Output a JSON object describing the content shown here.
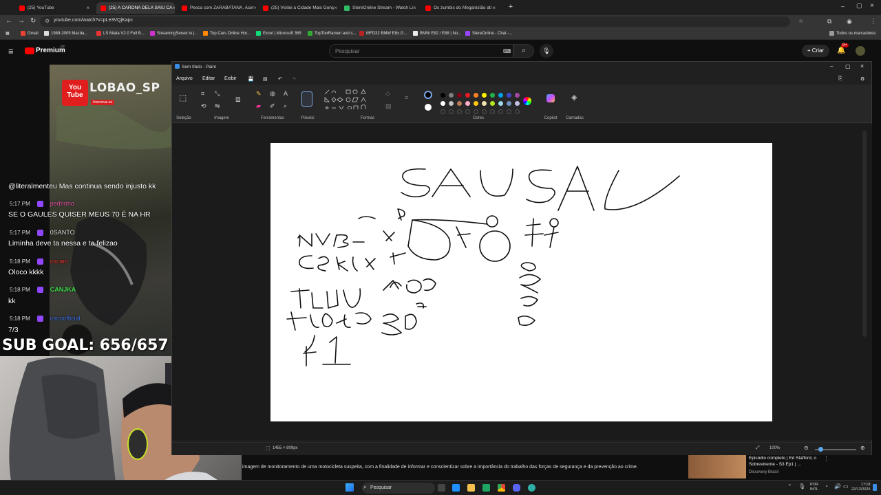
{
  "browser": {
    "tabs": [
      {
        "label": "(25) YouTube",
        "color": "#ff0000"
      },
      {
        "label": "(25) A CARONA DELA SAIU CA",
        "color": "#ff0000"
      },
      {
        "label": "Pesca com ZARABATANA. Acer",
        "color": "#ff0000"
      },
      {
        "label": "(25) Visitei a Cidade Mais Gonç",
        "color": "#ff0000"
      },
      {
        "label": "StereOnline Stream - Watch Li",
        "color": "#33bb66"
      },
      {
        "label": "Os zumbis do Afeganistão ati",
        "color": "#ff0000"
      }
    ],
    "url": "youtube.com/watch?v=pLe3VQjKapc",
    "bookmarks": [
      "Gmail",
      "1989-2005 Mazda...",
      "LS Miata V2.0 Full B...",
      "StreamingServer.io |...",
      "Top Cars Online Hor...",
      "Excel | Microsoft 365",
      "TopTierRamen and s...",
      "MFD32 BMW E8x G...",
      "BMW E82 / E88 | No...",
      "StereOnline - Chat -..."
    ],
    "all_bookmarks": "Todos os marcadores"
  },
  "youtube": {
    "brand": "Premium",
    "region": "PT",
    "search_placeholder": "Pesquisar",
    "create_label": "Criar",
    "notif_count": "9+"
  },
  "stream": {
    "channel_name": "LOBAO_SP",
    "subscribe_tag": "Inscreva-se",
    "chat": [
      {
        "time": "",
        "user": "",
        "text": "@literalmenteu Mas continua sendo injusto kk"
      },
      {
        "time": "5:17 PM",
        "user": "pedrinho",
        "text": "SE O GAULES QUISER MEUS 70 É NA HR"
      },
      {
        "time": "5:17 PM",
        "user": "0SANTO",
        "text": "Liminha deve ta nessa e ta felizao"
      },
      {
        "time": "5:18 PM",
        "user": "cscam",
        "text": "Oloco kkkk"
      },
      {
        "time": "5:18 PM",
        "user": "CANJKA",
        "text": "kk"
      },
      {
        "time": "5:18 PM",
        "user": "cscoofficial",
        "text": "7/3"
      }
    ],
    "sub_goal": "SUB GOAL: 656/657"
  },
  "paint": {
    "window_title": "Sem título - Paint",
    "menu": [
      "Arquivo",
      "Editar",
      "Exibir"
    ],
    "groups": [
      "Seleção",
      "Imagem",
      "Ferramentas",
      "Pincéis",
      "Formas",
      "Cores",
      "Copilot",
      "Camadas"
    ],
    "canvas_size": "1455 × 809px",
    "zoom": "100%"
  },
  "drawing_text": {
    "title": "SAUSAU",
    "labels": [
      "NBA",
      "CS",
      "FUT",
      "Futsal",
      "F1",
      "Leo"
    ]
  },
  "video": {
    "caption": "imagem de monitoramento de uma motocicleta suspeita, com a finalidade de informar e conscientizar sobre a importância do trabalho das forças de segurança e da prevenção ao crime.",
    "rec_title": "Episódio completo | Ed Stafford, o Sobrevivente - S3 Ep1 | ...",
    "rec_channel": "Discovery Brasil"
  },
  "taskbar": {
    "search_label": "Pesquisar",
    "lang_line1": "POR",
    "lang_line2": "INTL",
    "time": "17:18",
    "date": "22/12/2025"
  }
}
